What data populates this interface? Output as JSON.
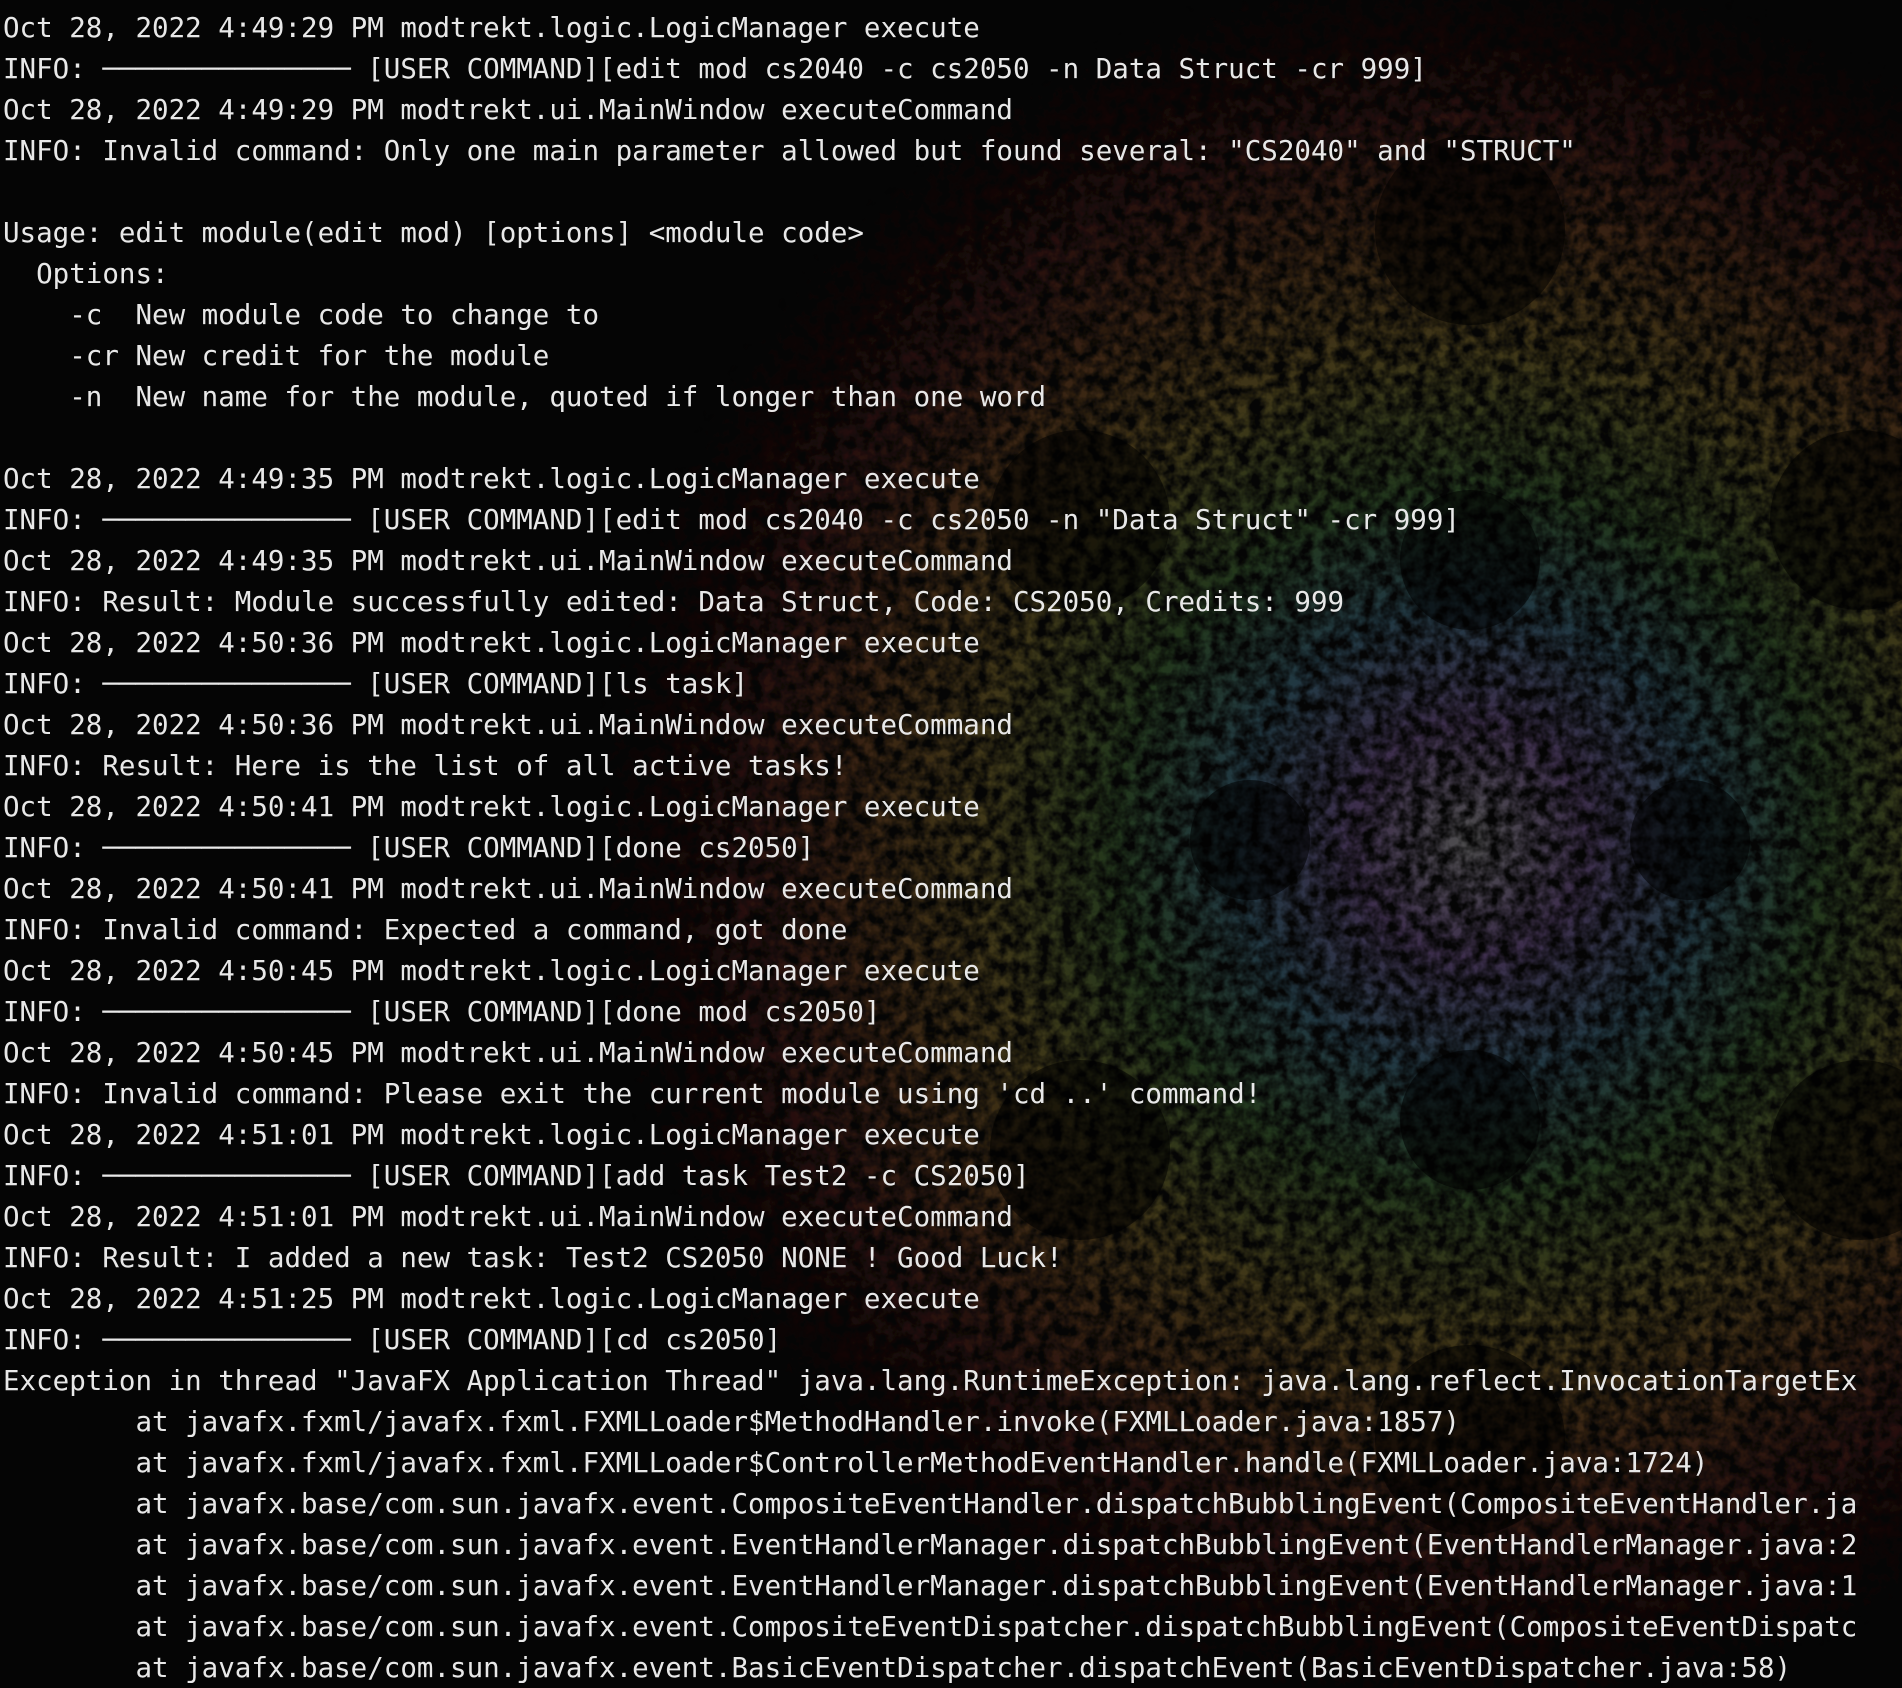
{
  "terminal": {
    "lines": [
      "Oct 28, 2022 4:49:29 PM modtrekt.logic.LogicManager execute",
      "INFO: ─────────────── [USER COMMAND][edit mod cs2040 -c cs2050 -n Data Struct -cr 999]",
      "Oct 28, 2022 4:49:29 PM modtrekt.ui.MainWindow executeCommand",
      "INFO: Invalid command: Only one main parameter allowed but found several: \"CS2040\" and \"STRUCT\"",
      "",
      "Usage: edit module(edit mod) [options] <module code>",
      "  Options:",
      "    -c  New module code to change to",
      "    -cr New credit for the module",
      "    -n  New name for the module, quoted if longer than one word",
      "",
      "Oct 28, 2022 4:49:35 PM modtrekt.logic.LogicManager execute",
      "INFO: ─────────────── [USER COMMAND][edit mod cs2040 -c cs2050 -n \"Data Struct\" -cr 999]",
      "Oct 28, 2022 4:49:35 PM modtrekt.ui.MainWindow executeCommand",
      "INFO: Result: Module successfully edited: Data Struct, Code: CS2050, Credits: 999",
      "Oct 28, 2022 4:50:36 PM modtrekt.logic.LogicManager execute",
      "INFO: ─────────────── [USER COMMAND][ls task]",
      "Oct 28, 2022 4:50:36 PM modtrekt.ui.MainWindow executeCommand",
      "INFO: Result: Here is the list of all active tasks!",
      "Oct 28, 2022 4:50:41 PM modtrekt.logic.LogicManager execute",
      "INFO: ─────────────── [USER COMMAND][done cs2050]",
      "Oct 28, 2022 4:50:41 PM modtrekt.ui.MainWindow executeCommand",
      "INFO: Invalid command: Expected a command, got done",
      "Oct 28, 2022 4:50:45 PM modtrekt.logic.LogicManager execute",
      "INFO: ─────────────── [USER COMMAND][done mod cs2050]",
      "Oct 28, 2022 4:50:45 PM modtrekt.ui.MainWindow executeCommand",
      "INFO: Invalid command: Please exit the current module using 'cd ..' command!",
      "Oct 28, 2022 4:51:01 PM modtrekt.logic.LogicManager execute",
      "INFO: ─────────────── [USER COMMAND][add task Test2 -c CS2050]",
      "Oct 28, 2022 4:51:01 PM modtrekt.ui.MainWindow executeCommand",
      "INFO: Result: I added a new task: Test2 CS2050 NONE ! Good Luck!",
      "Oct 28, 2022 4:51:25 PM modtrekt.logic.LogicManager execute",
      "INFO: ─────────────── [USER COMMAND][cd cs2050]",
      "Exception in thread \"JavaFX Application Thread\" java.lang.RuntimeException: java.lang.reflect.InvocationTargetEx",
      "        at javafx.fxml/javafx.fxml.FXMLLoader$MethodHandler.invoke(FXMLLoader.java:1857)",
      "        at javafx.fxml/javafx.fxml.FXMLLoader$ControllerMethodEventHandler.handle(FXMLLoader.java:1724)",
      "        at javafx.base/com.sun.javafx.event.CompositeEventHandler.dispatchBubblingEvent(CompositeEventHandler.ja",
      "        at javafx.base/com.sun.javafx.event.EventHandlerManager.dispatchBubblingEvent(EventHandlerManager.java:2",
      "        at javafx.base/com.sun.javafx.event.EventHandlerManager.dispatchBubblingEvent(EventHandlerManager.java:1",
      "        at javafx.base/com.sun.javafx.event.CompositeEventDispatcher.dispatchBubblingEvent(CompositeEventDispatc",
      "        at javafx.base/com.sun.javafx.event.BasicEventDispatcher.dispatchEvent(BasicEventDispatcher.java:58)"
    ]
  },
  "colors": {
    "background": "#050505",
    "text": "#e8e8e8"
  }
}
